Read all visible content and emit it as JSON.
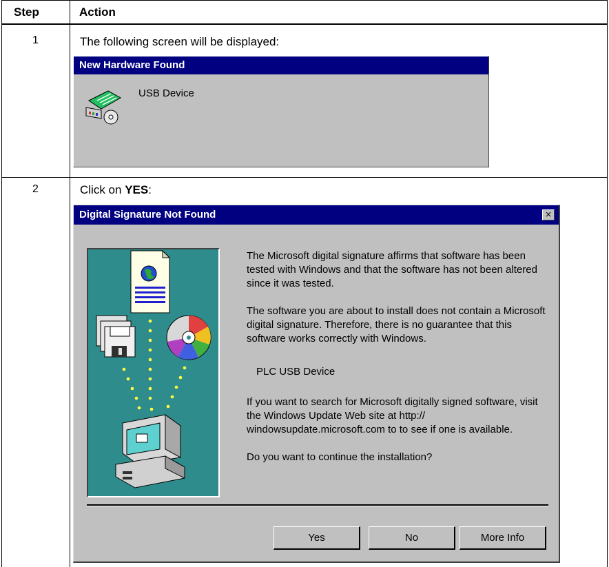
{
  "table": {
    "col_step": "Step",
    "col_action": "Action"
  },
  "rows": [
    {
      "step": "1",
      "action": "The following screen will be displayed:",
      "dialog": {
        "title": "New Hardware Found",
        "device": "USB Device",
        "icon": "hardware-card-icon"
      }
    },
    {
      "step": "2",
      "action_prefix": "Click on ",
      "action_bold": "YES",
      "action_suffix": ":",
      "dialog": {
        "title": "Digital Signature Not Found",
        "close_glyph": "×",
        "paragraph1": "The Microsoft digital signature affirms that software has been tested with Windows and that the software has not been altered since it was tested.",
        "paragraph2": "The software you are about to install does not contain a Microsoft digital signature. Therefore, there is no guarantee that this software works correctly with Windows.",
        "device": "PLC USB Device",
        "paragraph3": "If you want to search for Microsoft digitally signed software, visit the Windows Update Web site at http:// windowsupdate.microsoft.com to to see if one is available.",
        "question": "Do you want to continue the installation?",
        "buttons": {
          "yes": "Yes",
          "no": "No",
          "more_info": "More Info"
        },
        "illustration_bg": "#2f8c8c"
      }
    }
  ]
}
